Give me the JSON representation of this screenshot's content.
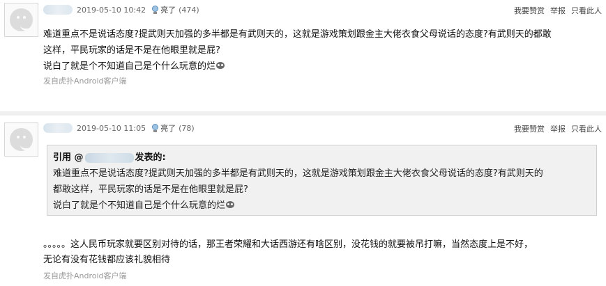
{
  "posts": [
    {
      "timestamp": "2019-05-10 10:42",
      "lit_label": "亮了",
      "lit_count": "(474)",
      "actions": [
        "我要赞赏",
        "举报",
        "只看此人"
      ],
      "content_lines": [
        "难道重点不是说话态度?提武则天加强的多半都是有武则天的，这就是游戏策划跟金主大佬衣食父母说话的态度?有武则天的都敢",
        "这样，平民玩家的话是不是在他眼里就是屁?",
        "说白了就是个不知道自己是个什么玩意的烂"
      ],
      "source": "发自虎扑Android客户端"
    },
    {
      "timestamp": "2019-05-10 11:05",
      "lit_label": "亮了",
      "lit_count": "(78)",
      "actions": [
        "我要赞赏",
        "举报",
        "只看此人"
      ],
      "quote": {
        "prefix": "引用 @",
        "suffix": "发表的:",
        "lines": [
          "难道重点不是说话态度?提武则天加强的多半都是有武则天的，这就是游戏策划跟金主大佬衣食父母说话的态度?有武则天的",
          "都敢这样，平民玩家的话是不是在他眼里就是屁?",
          "说白了就是个不知道自己是个什么玩意的烂"
        ]
      },
      "reply_lines": [
        "。。。。。这人民币玩家就要区别对待的话，那王者荣耀和大话西游还有啥区别，没花钱的就要被吊打嘛，当然态度上是不好，",
        "无论有没有花钱都应该礼貌相待"
      ],
      "source": "发自虎扑Android客户端"
    }
  ]
}
